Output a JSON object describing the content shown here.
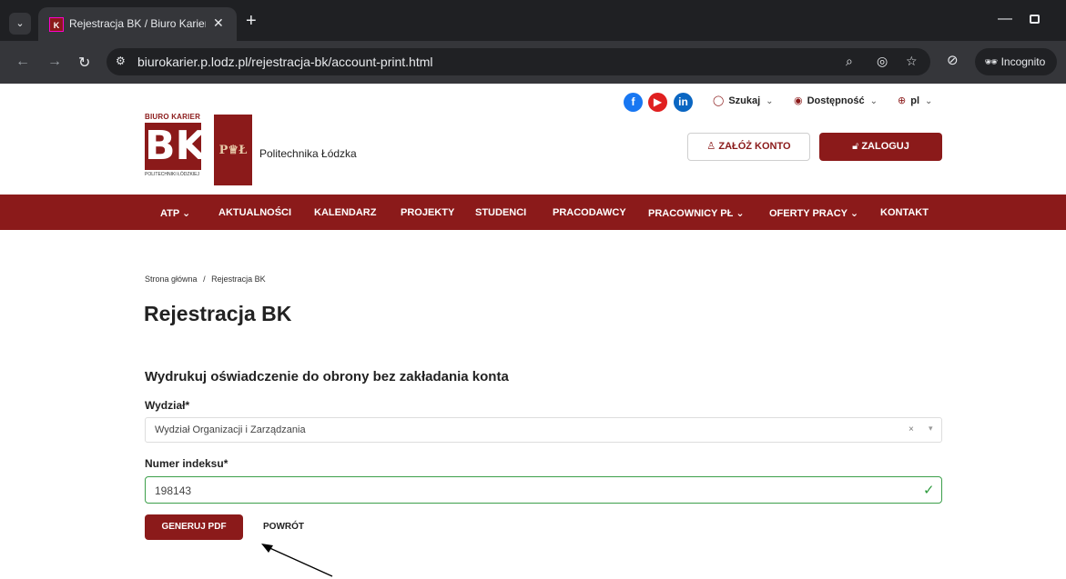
{
  "browser": {
    "tab_title": "Rejestracja BK / Biuro Karier - P",
    "url": "biurokarier.p.lodz.pl/rejestracja-bk/account-print.html",
    "incognito_label": "Incognito"
  },
  "header": {
    "bk_logo_top": "BIURO KARIER",
    "bk_logo_letters": "BK",
    "bk_logo_bottom": "POLITECHNIKI ŁÓDZKIEJ",
    "pl_logo_letters": "P♕Ł",
    "university_name": "Politechnika Łódzka",
    "search_label": "Szukaj",
    "accessibility_label": "Dostępność",
    "language_label": "pl",
    "register_button": "ZAŁÓŻ KONTO",
    "login_button": "ZALOGUJ"
  },
  "nav": {
    "items": [
      "ATP",
      "AKTUALNOŚCI",
      "KALENDARZ",
      "PROJEKTY",
      "STUDENCI",
      "PRACODAWCY",
      "PRACOWNICY PŁ",
      "OFERTY PRACY",
      "KONTAKT"
    ]
  },
  "breadcrumb": {
    "home": "Strona główna",
    "separator": "/",
    "current": "Rejestracja BK"
  },
  "page": {
    "title": "Rejestracja BK",
    "section_title": "Wydrukuj oświadczenie do obrony bez zakładania konta"
  },
  "form": {
    "faculty_label": "Wydział*",
    "faculty_value": "Wydział Organizacji i Zarządzania",
    "index_label": "Numer indeksu*",
    "index_value": "198143",
    "generate_button": "GENERUJ PDF",
    "back_button": "POWRÓT"
  },
  "colors": {
    "brand": "#8b1a1a",
    "valid": "#2e9b3e"
  }
}
